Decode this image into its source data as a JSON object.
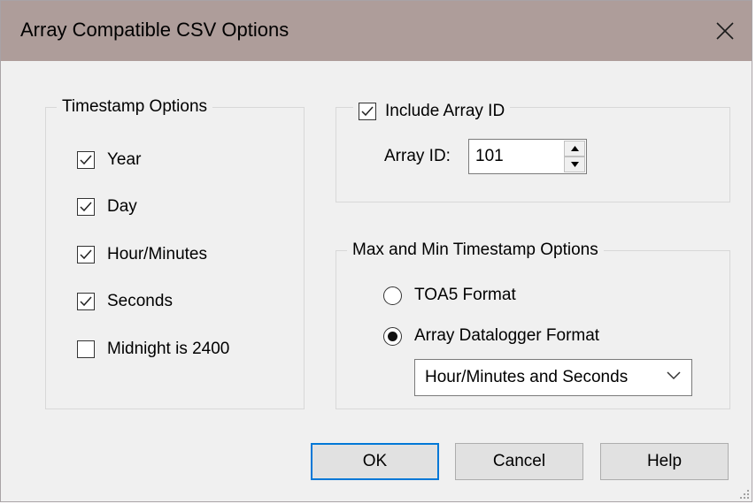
{
  "window": {
    "title": "Array Compatible CSV Options",
    "close_glyph": "✕"
  },
  "timestamp_options": {
    "title": "Timestamp Options",
    "items": [
      {
        "label": "Year",
        "checked": true
      },
      {
        "label": "Day",
        "checked": true
      },
      {
        "label": "Hour/Minutes",
        "checked": true
      },
      {
        "label": "Seconds",
        "checked": true
      },
      {
        "label": "Midnight is 2400",
        "checked": false
      }
    ]
  },
  "array_id": {
    "include_label": "Include Array ID",
    "include_checked": true,
    "field_label": "Array ID:",
    "value": "101"
  },
  "maxmin": {
    "title": "Max and Min Timestamp Options",
    "options": [
      {
        "label": "TOA5 Format",
        "selected": false
      },
      {
        "label": "Array Datalogger Format",
        "selected": true
      }
    ],
    "select_value": "Hour/Minutes and Seconds"
  },
  "buttons": {
    "ok": "OK",
    "cancel": "Cancel",
    "help": "Help"
  },
  "colors": {
    "titlebar": "#ae9d9a",
    "dialog_bg": "#f0f0f0",
    "default_border": "#0078d7"
  }
}
